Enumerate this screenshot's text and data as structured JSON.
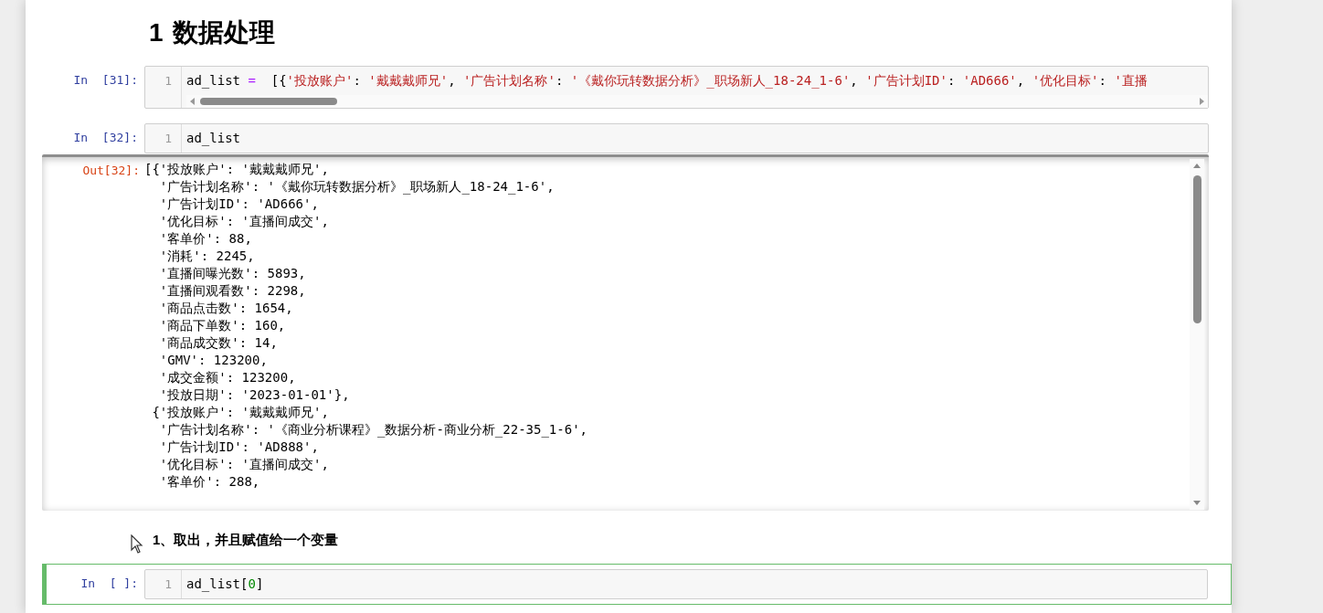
{
  "heading": {
    "number": "1",
    "title": "数据处理"
  },
  "cells": [
    {
      "kind": "code",
      "prompt": "In  [31]:",
      "selected": false,
      "line_number": "1",
      "horizontal_scrollbar": true,
      "tokens": [
        {
          "kind": "name",
          "text": "ad_list"
        },
        {
          "kind": "op",
          "text": " = "
        },
        {
          "kind": "plain",
          "text": " [{"
        },
        {
          "kind": "string",
          "text": "'投放账户'"
        },
        {
          "kind": "plain",
          "text": ": "
        },
        {
          "kind": "string",
          "text": "'戴戴戴师兄'"
        },
        {
          "kind": "plain",
          "text": ", "
        },
        {
          "kind": "string",
          "text": "'广告计划名称'"
        },
        {
          "kind": "plain",
          "text": ": "
        },
        {
          "kind": "string",
          "text": "'《戴你玩转数据分析》_职场新人_18-24_1-6'"
        },
        {
          "kind": "plain",
          "text": ", "
        },
        {
          "kind": "string",
          "text": "'广告计划ID'"
        },
        {
          "kind": "plain",
          "text": ": "
        },
        {
          "kind": "string",
          "text": "'AD666'"
        },
        {
          "kind": "plain",
          "text": ", "
        },
        {
          "kind": "string",
          "text": "'优化目标'"
        },
        {
          "kind": "plain",
          "text": ": "
        },
        {
          "kind": "string",
          "text": "'直播"
        }
      ]
    },
    {
      "kind": "code",
      "prompt": "In  [32]:",
      "selected": false,
      "line_number": "1",
      "horizontal_scrollbar": false,
      "tokens": [
        {
          "kind": "name",
          "text": "ad_list"
        }
      ],
      "output": {
        "prompt": "Out[32]:",
        "lines": [
          "[{'投放账户': '戴戴戴师兄',",
          "  '广告计划名称': '《戴你玩转数据分析》_职场新人_18-24_1-6',",
          "  '广告计划ID': 'AD666',",
          "  '优化目标': '直播间成交',",
          "  '客单价': 88,",
          "  '消耗': 2245,",
          "  '直播间曝光数': 5893,",
          "  '直播间观看数': 2298,",
          "  '商品点击数': 1654,",
          "  '商品下单数': 160,",
          "  '商品成交数': 14,",
          "  'GMV': 123200,",
          "  '成交金额': 123200,",
          "  '投放日期': '2023-01-01'},",
          " {'投放账户': '戴戴戴师兄',",
          "  '广告计划名称': '《商业分析课程》_数据分析-商业分析_22-35_1-6',",
          "  '广告计划ID': 'AD888',",
          "  '优化目标': '直播间成交',",
          "  '客单价': 288,"
        ]
      }
    },
    {
      "kind": "markdown",
      "text": "1、取出，并且赋值给一个变量",
      "selected": false
    },
    {
      "kind": "code",
      "prompt": "In  [ ]:",
      "selected": true,
      "line_number": "1",
      "horizontal_scrollbar": false,
      "tokens": [
        {
          "kind": "name",
          "text": "ad_list"
        },
        {
          "kind": "plain",
          "text": "["
        },
        {
          "kind": "number",
          "text": "0"
        },
        {
          "kind": "plain",
          "text": "]"
        }
      ]
    }
  ]
}
